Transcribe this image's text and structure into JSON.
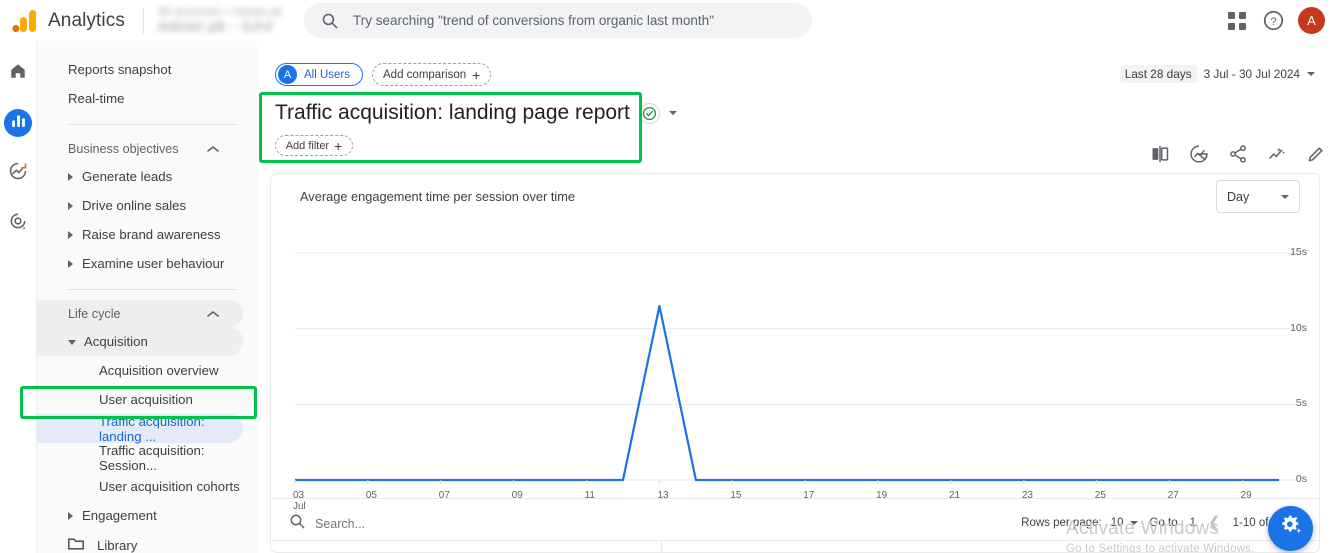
{
  "topbar": {
    "brand": "Analytics",
    "account_line1": "All accounts > Adnan.pk",
    "account_line2": "Adnan.pk - GA4",
    "search_placeholder": "Try searching \"trend of conversions from organic last month\"",
    "apps_icon": "apps-grid-icon",
    "help_icon": "help-icon",
    "avatar_initial": "A"
  },
  "rail": [
    {
      "name": "home",
      "icon": "home-icon",
      "active": false
    },
    {
      "name": "reports",
      "icon": "bar-chart-icon",
      "active": true
    },
    {
      "name": "explore",
      "icon": "explore-icon",
      "active": false
    },
    {
      "name": "advertising",
      "icon": "advertising-target-icon",
      "active": false
    }
  ],
  "sidebar": {
    "top_links": [
      {
        "label": "Reports snapshot"
      },
      {
        "label": "Real-time"
      }
    ],
    "business_objectives": {
      "label": "Business objectives",
      "expanded": true,
      "items": [
        {
          "label": "Generate leads"
        },
        {
          "label": "Drive online sales"
        },
        {
          "label": "Raise brand awareness"
        },
        {
          "label": "Examine user behaviour"
        }
      ]
    },
    "life_cycle": {
      "label": "Life cycle",
      "expanded": true,
      "acquisition": {
        "label": "Acquisition"
      },
      "acquisition_items": [
        {
          "label": "Acquisition overview",
          "selected": false
        },
        {
          "label": "User acquisition",
          "selected": false
        },
        {
          "label": "Traffic acquisition: landing ...",
          "selected": true
        },
        {
          "label": "Traffic acquisition: Session...",
          "selected": false
        },
        {
          "label": "User acquisition cohorts",
          "selected": false
        }
      ],
      "engagement": {
        "label": "Engagement"
      }
    },
    "library": {
      "label": "Library",
      "icon": "folder-icon"
    }
  },
  "main": {
    "audience_chip": {
      "initial": "A",
      "label": "All Users"
    },
    "add_comparison": {
      "label": "Add comparison",
      "icon": "plus-icon"
    },
    "date_range": {
      "preset": "Last 28 days",
      "range": "3 Jul - 30 Jul 2024"
    },
    "report_title": "Traffic acquisition: landing page report",
    "title_badge_icon": "check-circle-icon",
    "add_filter": {
      "label": "Add filter",
      "icon": "plus-icon"
    },
    "tools": [
      {
        "name": "compare-icon"
      },
      {
        "name": "insights-icon"
      },
      {
        "name": "share-icon"
      },
      {
        "name": "trend-insights-icon"
      },
      {
        "name": "edit-pencil-icon"
      }
    ]
  },
  "card": {
    "chart_title": "Average engagement time per session over time",
    "granularity": "Day",
    "table_search_placeholder": "Search...",
    "rows_per_page_label": "Rows per page:",
    "rows_per_page_value": "10",
    "goto_label": "Go to",
    "goto_value": "1",
    "range_label": "1-10 of 12",
    "prev_icon": "chevron-left-icon",
    "next_icon": "chevron-right-icon"
  },
  "chart_data": {
    "type": "line",
    "title": "Average engagement time per session over time",
    "xlabel": "",
    "ylabel": "",
    "granularity": "Day",
    "grid": true,
    "legend": false,
    "line_color": "#1a73e8",
    "ylim": [
      0,
      15
    ],
    "yticks": [
      0,
      5,
      10,
      15
    ],
    "ytick_labels": [
      "0s",
      "5s",
      "10s",
      "15s"
    ],
    "xtick_labels": [
      "03",
      "05",
      "07",
      "09",
      "11",
      "13",
      "15",
      "17",
      "19",
      "21",
      "23",
      "25",
      "27",
      "29"
    ],
    "x_axis_unit": "Jul",
    "x": [
      "03 Jul",
      "04 Jul",
      "05 Jul",
      "06 Jul",
      "07 Jul",
      "08 Jul",
      "09 Jul",
      "10 Jul",
      "11 Jul",
      "12 Jul",
      "13 Jul",
      "14 Jul",
      "15 Jul",
      "16 Jul",
      "17 Jul",
      "18 Jul",
      "19 Jul",
      "20 Jul",
      "21 Jul",
      "22 Jul",
      "23 Jul",
      "24 Jul",
      "25 Jul",
      "26 Jul",
      "27 Jul",
      "28 Jul",
      "29 Jul",
      "30 Jul"
    ],
    "series": [
      {
        "name": "Average engagement time per session",
        "values": [
          0,
          0,
          0,
          0,
          0,
          0,
          0,
          0,
          0,
          0,
          11.5,
          0,
          0,
          0,
          0,
          0,
          0,
          0,
          0,
          0,
          0,
          0,
          0,
          0,
          0,
          0,
          0,
          0
        ]
      }
    ]
  },
  "os_watermark": {
    "line1": "Activate Windows",
    "line2": "Go to Settings to activate Windows."
  },
  "fab": {
    "icon": "gear-sparkle-icon"
  },
  "colors": {
    "accent": "#1a73e8",
    "brand_orange": "#f9ab00",
    "annotation_green": "#00c24a",
    "avatar_red": "#c5381d"
  }
}
